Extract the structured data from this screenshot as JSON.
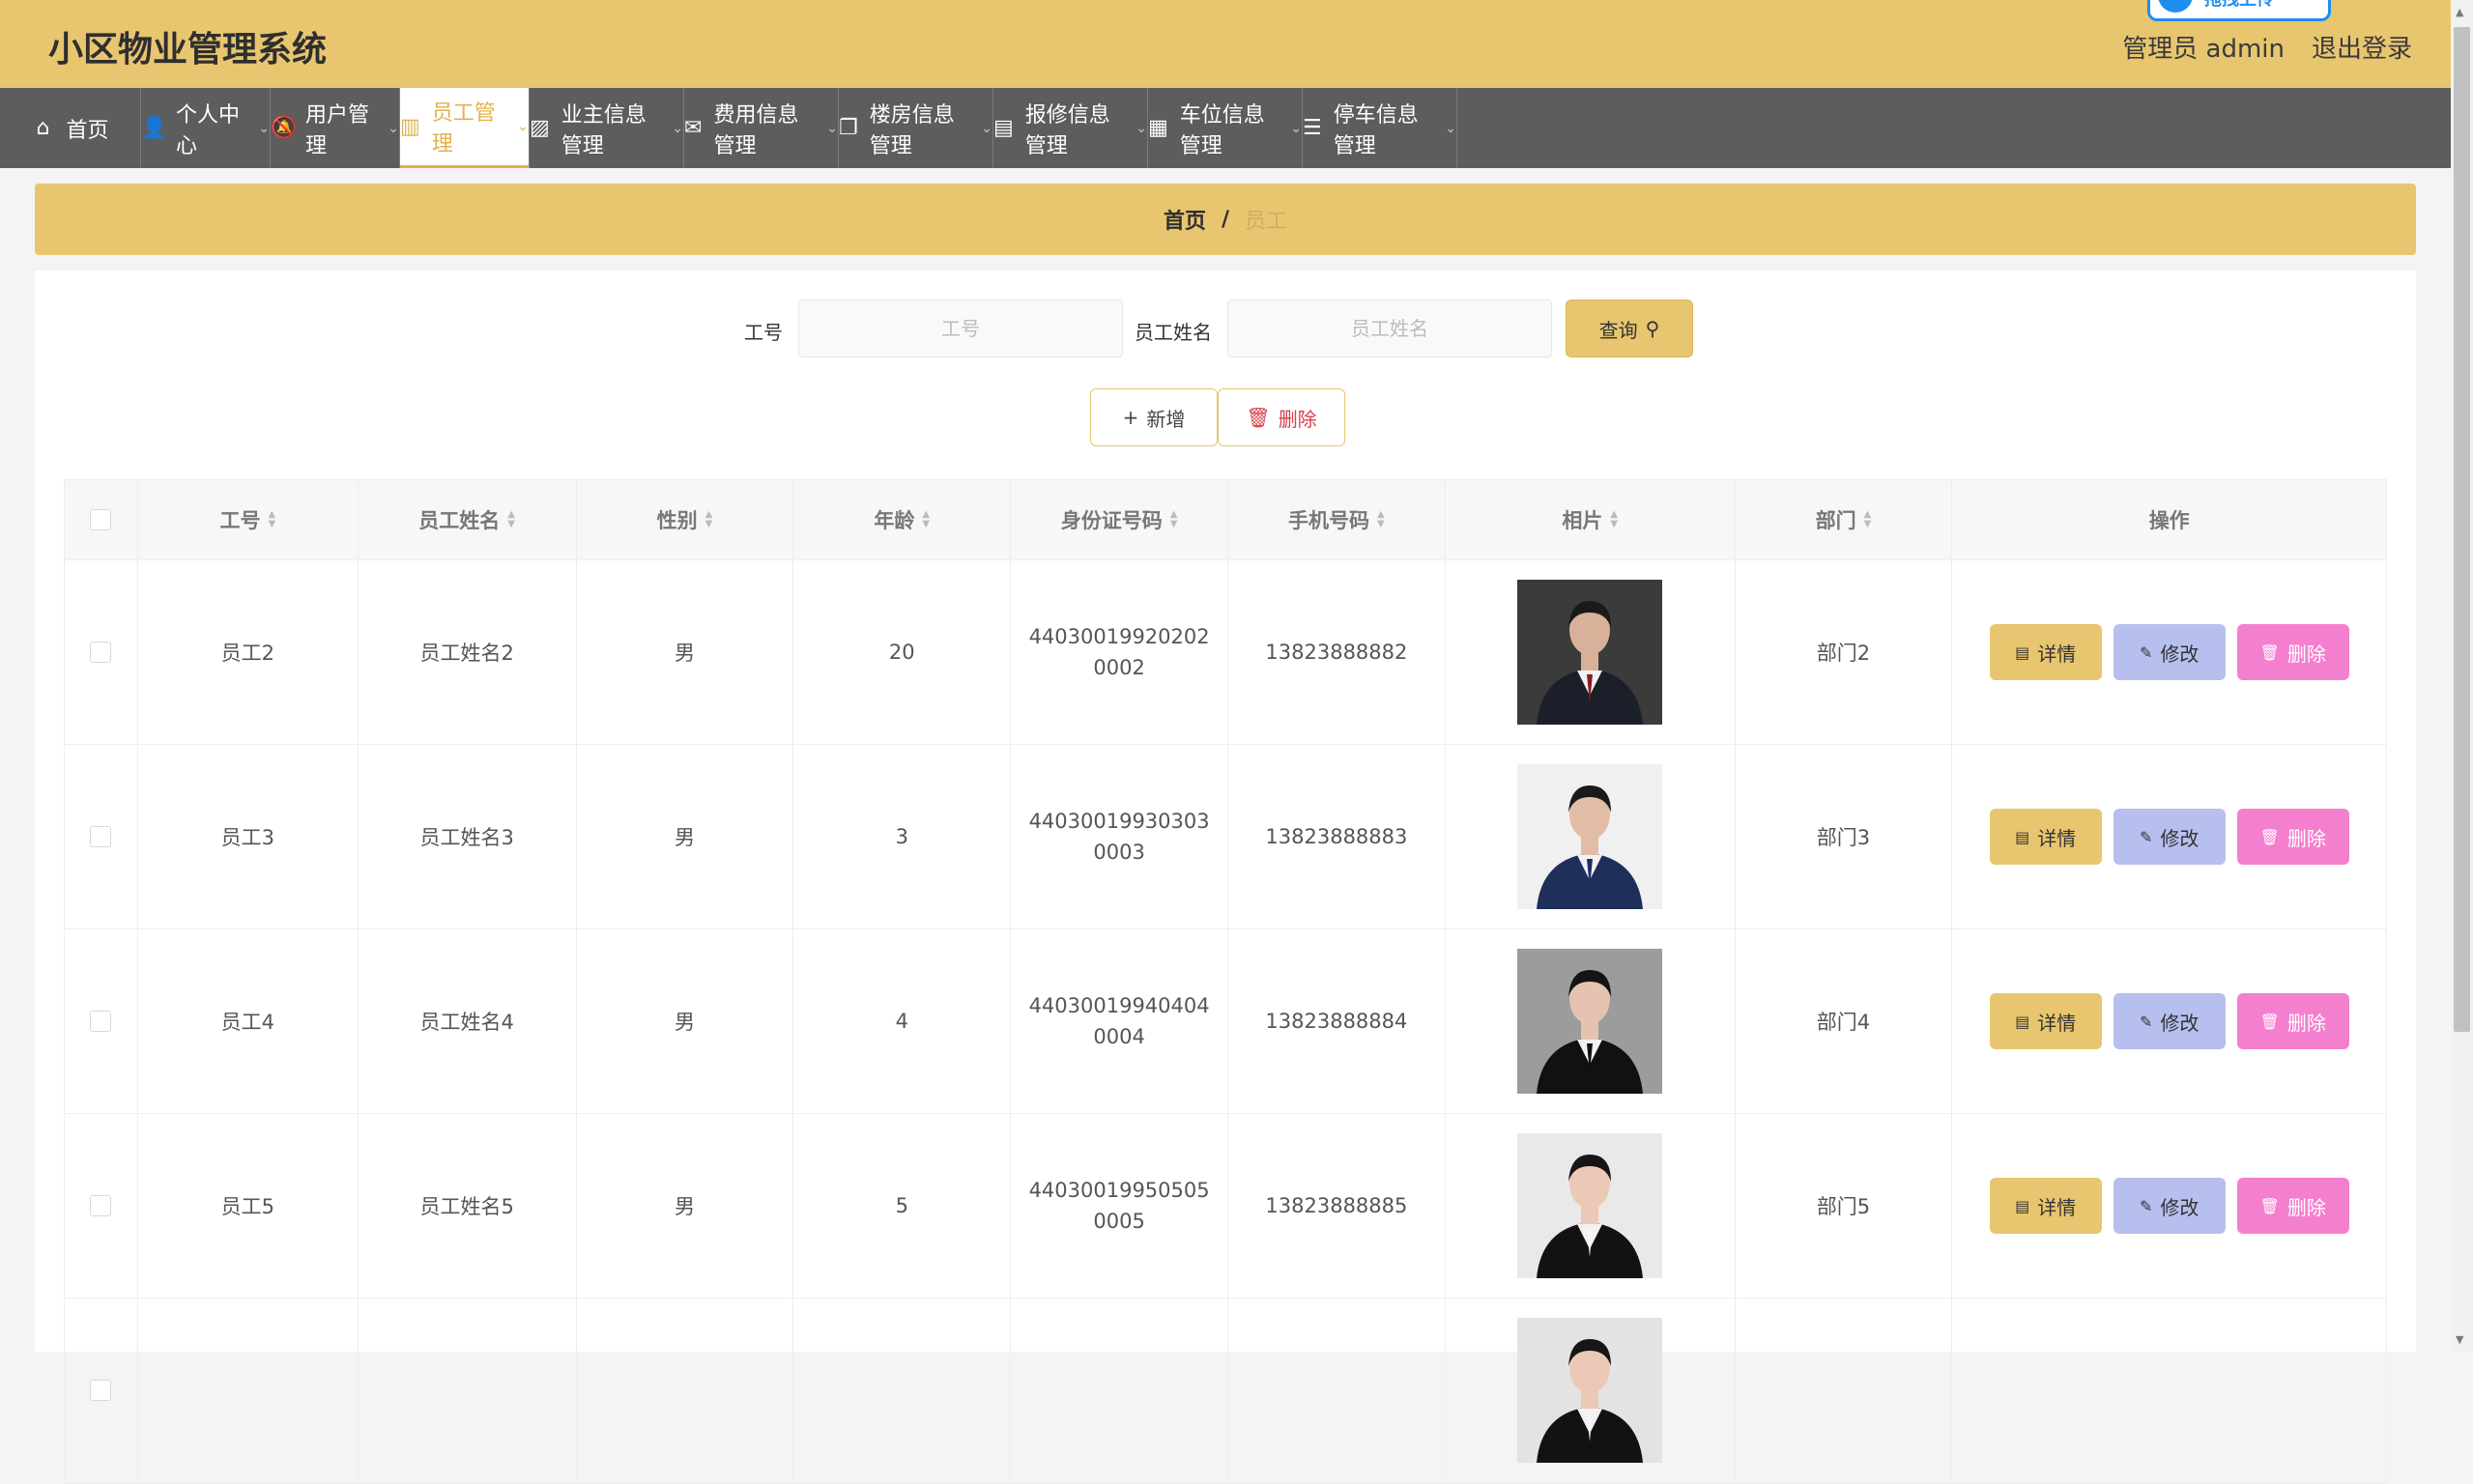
{
  "header": {
    "title": "小区物业管理系统",
    "user": "管理员 admin",
    "logout": "退出登录",
    "badge": "拖拽上传"
  },
  "nav": [
    {
      "label": "首页",
      "icon": "home-icon",
      "glyph": "⌂",
      "chevron": false,
      "active": false
    },
    {
      "label": "个人中心",
      "icon": "user-icon",
      "glyph": "👤",
      "chevron": true,
      "active": false
    },
    {
      "label": "用户管理",
      "icon": "bell-off-icon",
      "glyph": "🔕",
      "chevron": true,
      "active": false
    },
    {
      "label": "员工管理",
      "icon": "books-icon",
      "glyph": "▥",
      "chevron": true,
      "active": true
    },
    {
      "label": "业主信息管理",
      "icon": "chart-icon",
      "glyph": "▨",
      "chevron": true,
      "active": false
    },
    {
      "label": "费用信息管理",
      "icon": "mail-icon",
      "glyph": "✉",
      "chevron": true,
      "active": false
    },
    {
      "label": "楼房信息管理",
      "icon": "copy-icon",
      "glyph": "❐",
      "chevron": true,
      "active": false
    },
    {
      "label": "报修信息管理",
      "icon": "briefcase-icon",
      "glyph": "▤",
      "chevron": true,
      "active": false
    },
    {
      "label": "车位信息管理",
      "icon": "clipboard-icon",
      "glyph": "▦",
      "chevron": true,
      "active": false
    },
    {
      "label": "停车信息管理",
      "icon": "list-icon",
      "glyph": "☰",
      "chevron": true,
      "active": false
    }
  ],
  "breadcrumb": {
    "home": "首页",
    "separator": "/",
    "current": "员工"
  },
  "search": {
    "id_label": "工号",
    "id_placeholder": "工号",
    "name_label": "员工姓名",
    "name_placeholder": "员工姓名",
    "query_button": "查询"
  },
  "actions": {
    "add": "新增",
    "delete": "删除"
  },
  "table": {
    "headers": [
      "工号",
      "员工姓名",
      "性别",
      "年龄",
      "身份证号码",
      "手机号码",
      "相片",
      "部门",
      "操作"
    ],
    "ops": {
      "detail": "详情",
      "edit": "修改",
      "delete": "删除"
    },
    "rows": [
      {
        "id": "员工2",
        "name": "员工姓名2",
        "gender": "男",
        "age": "20",
        "idcard": "440300199202020002",
        "phone": "13823888882",
        "dept": "部门2",
        "photo": {
          "bg": "#3b3b3b",
          "suit": "#1b1f2a",
          "tie": "#8a1c1c",
          "hair": "#1a1a1a",
          "skin": "#d9b19a"
        }
      },
      {
        "id": "员工3",
        "name": "员工姓名3",
        "gender": "男",
        "age": "3",
        "idcard": "440300199303030003",
        "phone": "13823888883",
        "dept": "部门3",
        "photo": {
          "bg": "#f0f0f0",
          "suit": "#1f2f5a",
          "tie": "#1c2e6b",
          "hair": "#1a1a1a",
          "skin": "#e2bca6"
        }
      },
      {
        "id": "员工4",
        "name": "员工姓名4",
        "gender": "男",
        "age": "4",
        "idcard": "440300199404040004",
        "phone": "13823888884",
        "dept": "部门4",
        "photo": {
          "bg": "#9c9c9c",
          "suit": "#111111",
          "tie": "#111111",
          "hair": "#141414",
          "skin": "#e6c3b0"
        }
      },
      {
        "id": "员工5",
        "name": "员工姓名5",
        "gender": "男",
        "age": "5",
        "idcard": "440300199505050005",
        "phone": "13823888885",
        "dept": "部门5",
        "photo": {
          "bg": "#e9e9e9",
          "suit": "#121212",
          "tie": "#f5f5f5",
          "hair": "#161616",
          "skin": "#ecc9b6"
        }
      },
      {
        "id": "",
        "name": "",
        "gender": "",
        "age": "",
        "idcard": "",
        "phone": "",
        "dept": "",
        "photo": {
          "bg": "#e3e3e3",
          "suit": "#121212",
          "tie": "#f5f5f5",
          "hair": "#161616",
          "skin": "#ecc9b6"
        }
      }
    ]
  },
  "colors": {
    "accent": "#e8c56f",
    "nav_bg": "#5d5d5d",
    "edit": "#b7bfee",
    "delete": "#f57fcf"
  }
}
